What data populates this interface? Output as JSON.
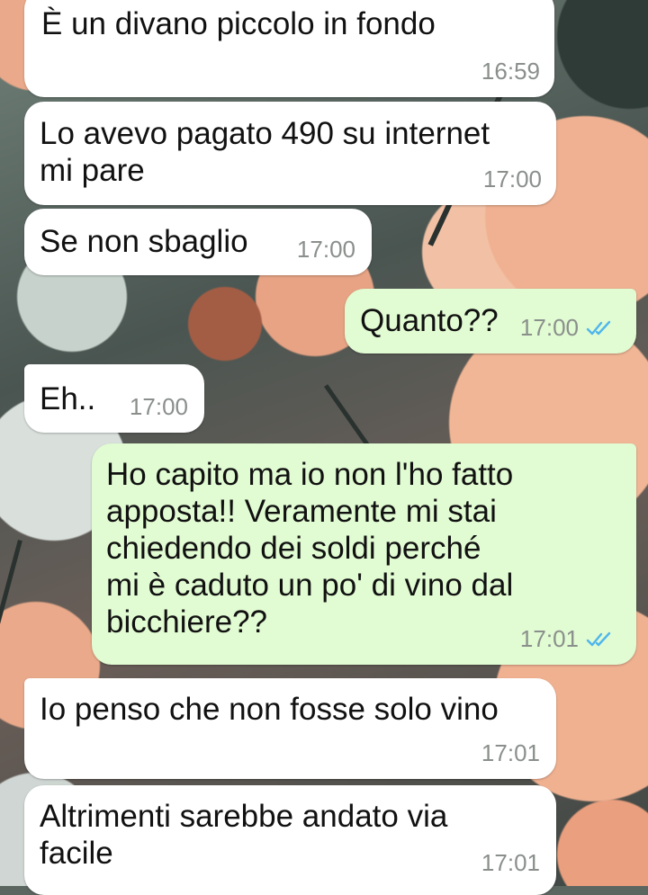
{
  "chat": {
    "messages": [
      {
        "direction": "incoming",
        "text": "È un divano piccolo in fondo",
        "time": "16:59"
      },
      {
        "direction": "incoming",
        "text": "Lo avevo pagato 490 su internet\nmi pare",
        "time": "17:00"
      },
      {
        "direction": "incoming",
        "text": "Se non sbaglio",
        "time": "17:00"
      },
      {
        "direction": "outgoing",
        "text": "Quanto??",
        "time": "17:00",
        "status_icon": "double-check-read-icon",
        "status_color": "#4fb6ec"
      },
      {
        "direction": "incoming",
        "text": "Eh..",
        "time": "17:00"
      },
      {
        "direction": "outgoing",
        "text": "Ho capito ma io non l'ho fatto\napposta!! Veramente mi stai\nchiedendo dei soldi perché\nmi è caduto un po' di vino dal\nbicchiere??",
        "time": "17:01",
        "status_icon": "double-check-read-icon",
        "status_color": "#4fb6ec"
      },
      {
        "direction": "incoming",
        "text": "Io penso che non fosse solo vino",
        "time": "17:01"
      },
      {
        "direction": "incoming",
        "text": "Altrimenti sarebbe andato via\nfacile",
        "time": "17:01"
      }
    ]
  },
  "colors": {
    "incoming_bubble": "#ffffff",
    "outgoing_bubble": "#e1fbd2",
    "timestamp": "#8a8f8c",
    "read_ticks": "#4fb6ec"
  }
}
